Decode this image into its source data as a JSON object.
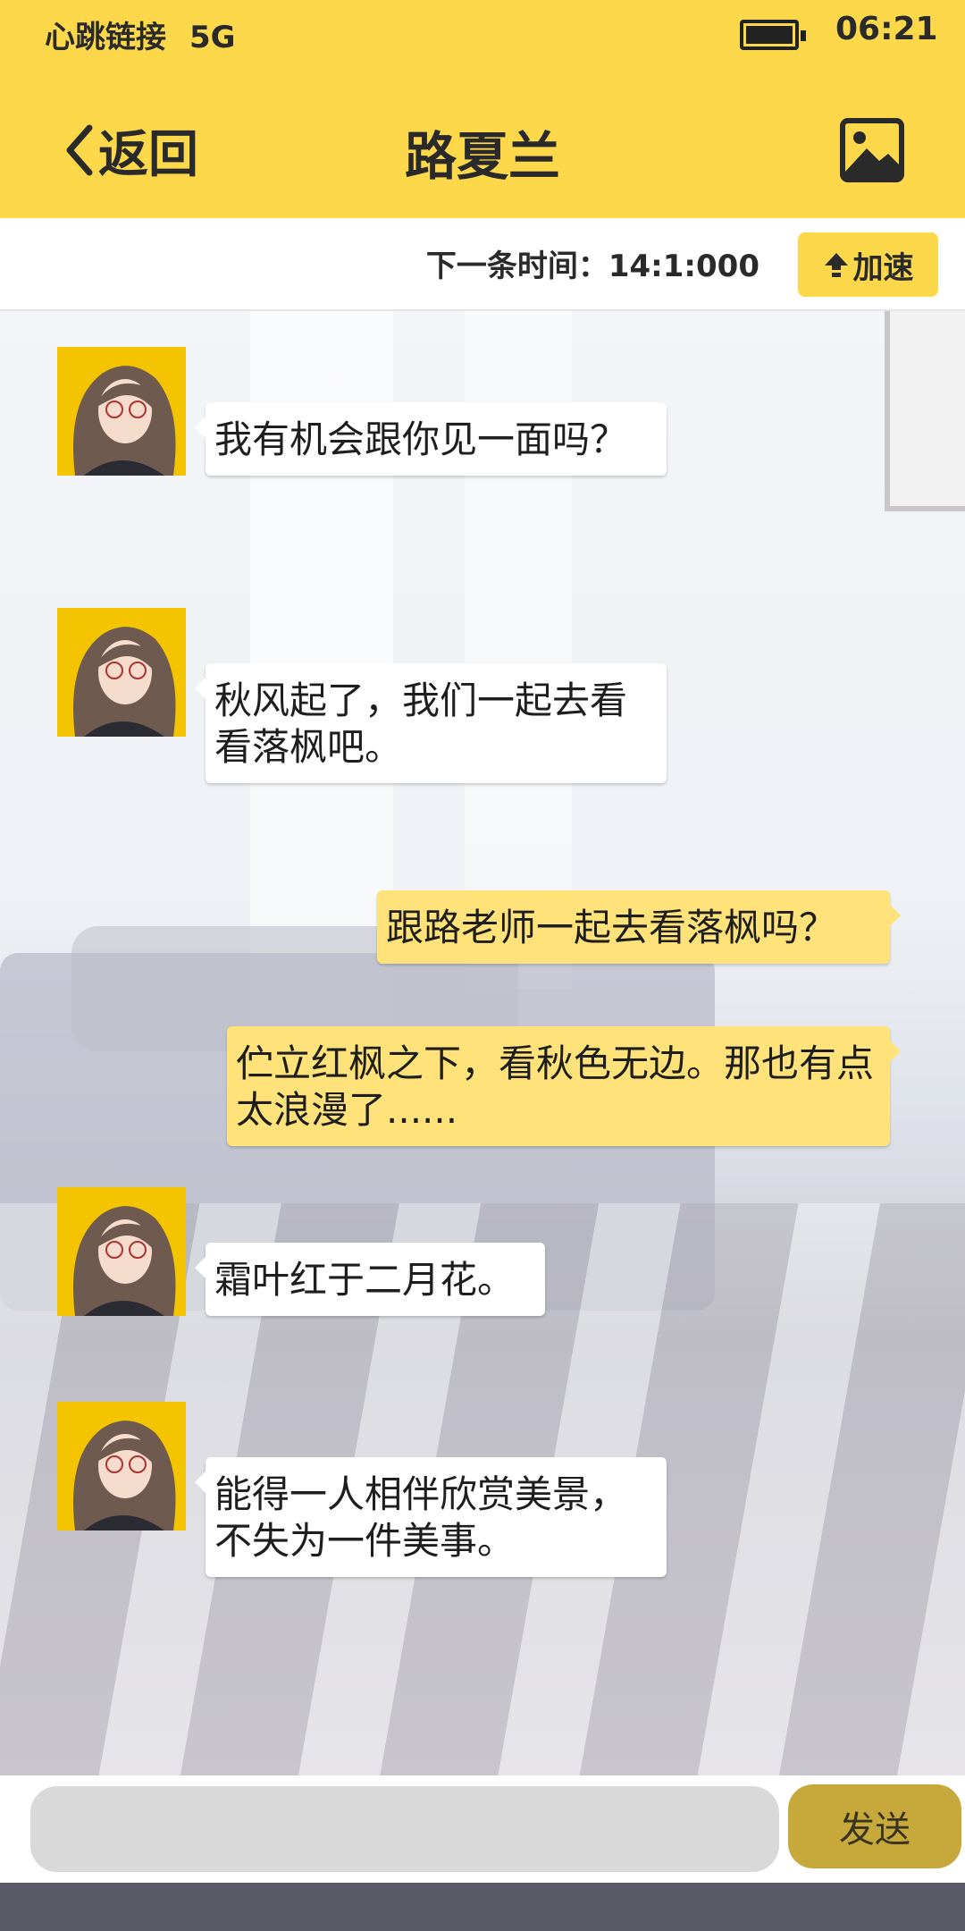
{
  "status_bar": {
    "carrier": "心跳链接",
    "network": "5G",
    "time": "06:21"
  },
  "header": {
    "back_label": "返回",
    "title": "路夏兰",
    "image_icon": "image-icon"
  },
  "info_bar": {
    "next_time_label": "下一条时间：14:1:000",
    "speed_button_label": "加速",
    "speed_icon": "up-arrow-icon"
  },
  "messages": [
    {
      "side": "left",
      "text": "我有机会跟你见一面吗？"
    },
    {
      "side": "left",
      "text": "秋风起了，我们一起去看看落枫吧。"
    },
    {
      "side": "right",
      "text": "跟路老师一起去看落枫吗？"
    },
    {
      "side": "right",
      "text": "伫立红枫之下，看秋色无边。那也有点太浪漫了......"
    },
    {
      "side": "left",
      "text": "霜叶红于二月花。"
    },
    {
      "side": "left",
      "text": "能得一人相伴欣赏美景，不失为一件美事。"
    }
  ],
  "input_bar": {
    "placeholder": "",
    "send_label": "发送"
  },
  "colors": {
    "accent": "#fdd84b",
    "bubble_right": "#ffe27a",
    "send_button": "#c6a93a"
  }
}
